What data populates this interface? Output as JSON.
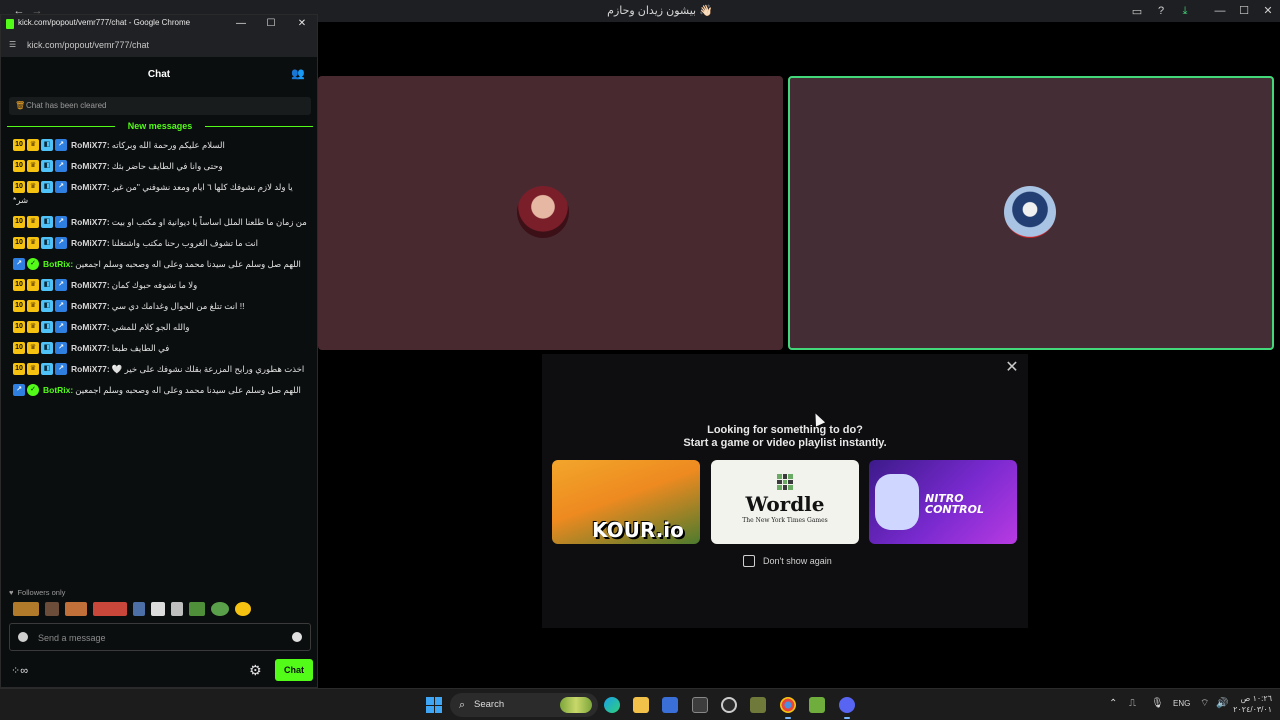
{
  "main_window": {
    "title": "بيشون زيدان وحازم 👋🏻",
    "controls": {
      "minimize": "—",
      "maximize": "☐",
      "close": "✕"
    }
  },
  "activity": {
    "close_icon": "✕",
    "line1": "Looking for something to do?",
    "line2": "Start a game or video playlist instantly.",
    "cards": [
      {
        "name": "kour-io-card",
        "label": "KOUR.io"
      },
      {
        "name": "wordle-card",
        "label": "Wordle",
        "sub": "The New York Times Games"
      },
      {
        "name": "nitro-control-card",
        "label": "NITRO CONTROL"
      }
    ],
    "dont_show": "Don't show again"
  },
  "chat_window": {
    "title": "kick.com/popout/vemr777/chat - Google Chrome",
    "url": "kick.com/popout/vemr777/chat",
    "controls": {
      "minimize": "—",
      "maximize": "☐",
      "close": "✕"
    },
    "header": "Chat",
    "cleared": "Chat has been cleared",
    "new_messages": "New messages",
    "messages": [
      {
        "user": "RoMiX77:",
        "text": "السلام عليكم ورحمة الله وبركاته",
        "bot": false
      },
      {
        "user": "RoMiX77:",
        "text": "وحتى وانا في الطايف حاضر بثك",
        "bot": false
      },
      {
        "user": "RoMiX77:",
        "text": "يا ولد لازم نشوفك كلها ٦ ايام ومعد نشوفني \"من غير",
        "text2": "*شر",
        "bot": false
      },
      {
        "user": "RoMiX77:",
        "text": "من زمان ما طلعنا الملل اساساً يا ديوانية او مكتب او بيت",
        "bot": false
      },
      {
        "user": "RoMiX77:",
        "text": "انت ما تشوف الغروب رحنا مكتب واشتغلنا",
        "bot": false
      },
      {
        "user": "BotRix:",
        "text": "اللهم صل وسلم على سيدنا محمد وعلى اله وصحبه وسلم اجمعين",
        "bot": true
      },
      {
        "user": "RoMiX77:",
        "text": "ولا ما تشوفه حبوك كمان",
        "bot": false
      },
      {
        "user": "RoMiX77:",
        "text": "!! انت تتلغ من الجوال وغدامك دي سي",
        "bot": false
      },
      {
        "user": "RoMiX77:",
        "text": "والله الجو كلام للمشي",
        "bot": false
      },
      {
        "user": "RoMiX77:",
        "text": "في الطايف طبعا",
        "bot": false
      },
      {
        "user": "RoMiX77:",
        "text": "اخذت هطوري ورايح المزرعة بقلك نشوفك على خير 🤍",
        "bot": false
      },
      {
        "user": "BotRix:",
        "text": "اللهم صل وسلم على سيدنا محمد وعلى اله وصحبه وسلم اجمعين",
        "bot": true
      }
    ],
    "badge_ten": "10",
    "followers_only": "Followers only",
    "input_placeholder": "Send a message",
    "chat_button": "Chat"
  },
  "taskbar": {
    "search": "Search",
    "lang": "ENG",
    "time": "١٠:٢٦ ص",
    "date": "٢٠٢٤/٠٣/٠١"
  },
  "colors": {
    "kick_green": "#53fc18",
    "speaking_border": "#43d97a",
    "tile_left": "#492930",
    "tile_right": "#452d35"
  }
}
